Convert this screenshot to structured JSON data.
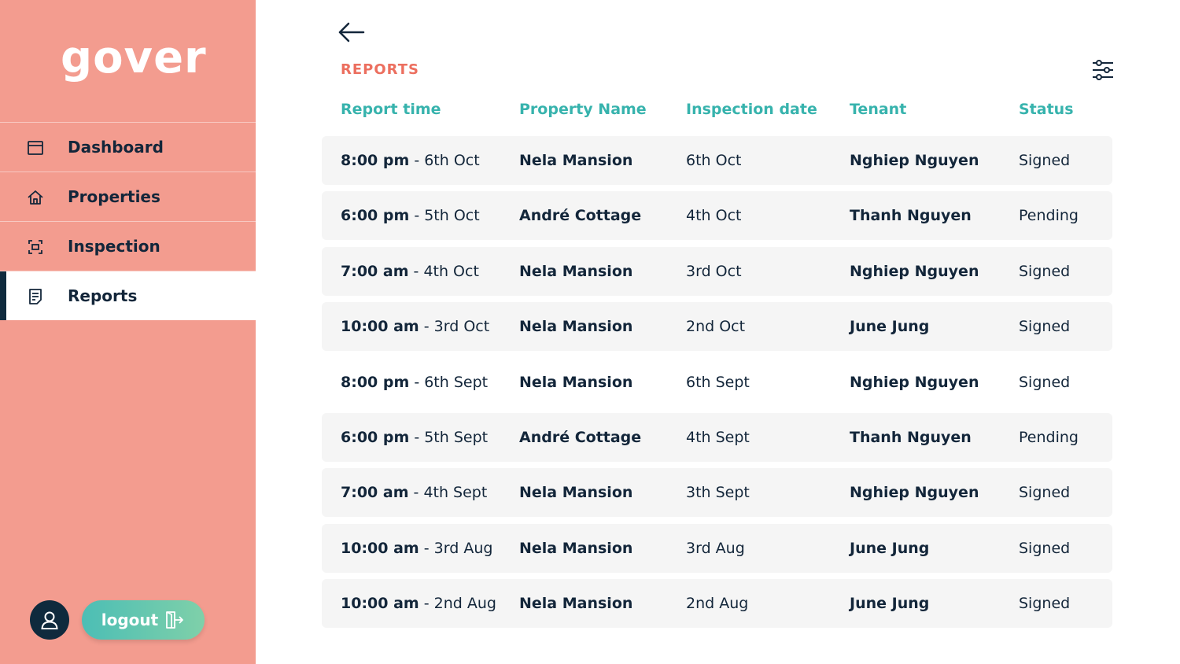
{
  "brand": {
    "name": "gover"
  },
  "sidebar": {
    "items": [
      {
        "label": "Dashboard",
        "icon": "dashboard-icon",
        "active": false
      },
      {
        "label": "Properties",
        "icon": "home-icon",
        "active": false
      },
      {
        "label": "Inspection",
        "icon": "scan-icon",
        "active": false
      },
      {
        "label": "Reports",
        "icon": "report-icon",
        "active": true
      }
    ],
    "logout_label": "logout"
  },
  "main": {
    "title": "REPORTS",
    "columns": [
      "Report time",
      "Property Name",
      "Inspection date",
      "Tenant",
      "Status"
    ],
    "rows": [
      {
        "time": "8:00 pm",
        "date": "6th Oct",
        "property": "Nela Mansion",
        "inspection": "6th Oct",
        "tenant": "Nghiep Nguyen",
        "status": "Signed"
      },
      {
        "time": "6:00 pm",
        "date": "5th Oct",
        "property": "André Cottage",
        "inspection": "4th Oct",
        "tenant": "Thanh Nguyen",
        "status": "Pending"
      },
      {
        "time": "7:00 am",
        "date": "4th Oct",
        "property": "Nela Mansion",
        "inspection": "3rd Oct",
        "tenant": "Nghiep Nguyen",
        "status": "Signed"
      },
      {
        "time": "10:00 am",
        "date": "3rd Oct",
        "property": "Nela Mansion",
        "inspection": "2nd Oct",
        "tenant": "June Jung",
        "status": "Signed"
      },
      {
        "time": "8:00 pm",
        "date": "6th Sept",
        "property": "Nela Mansion",
        "inspection": "6th Sept",
        "tenant": "Nghiep Nguyen",
        "status": "Signed"
      },
      {
        "time": "6:00 pm",
        "date": "5th Sept",
        "property": "André Cottage",
        "inspection": "4th Sept",
        "tenant": "Thanh Nguyen",
        "status": "Pending"
      },
      {
        "time": "7:00 am",
        "date": "4th Sept",
        "property": "Nela Mansion",
        "inspection": "3th Sept",
        "tenant": "Nghiep Nguyen",
        "status": "Signed"
      },
      {
        "time": "10:00 am",
        "date": "3rd Aug",
        "property": "Nela Mansion",
        "inspection": "3rd Aug",
        "tenant": "June Jung",
        "status": "Signed"
      },
      {
        "time": "10:00 am",
        "date": "2nd Aug",
        "property": "Nela Mansion",
        "inspection": "2nd Aug",
        "tenant": "June Jung",
        "status": "Signed"
      }
    ]
  },
  "colors": {
    "sidebar_bg": "#f39c8f",
    "navy": "#0f2a3d",
    "teal": "#37b3ad",
    "title_coral": "#ec6f5f",
    "row_bg": "#f5f5f5"
  }
}
